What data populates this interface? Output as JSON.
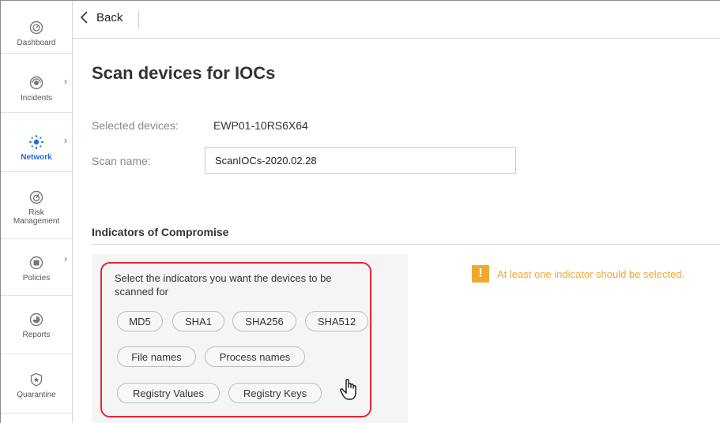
{
  "sidebar": {
    "items": [
      {
        "label": "Dashboard",
        "icon": "dashboard-icon"
      },
      {
        "label": "Incidents",
        "icon": "incidents-icon"
      },
      {
        "label": "Network",
        "icon": "network-icon"
      },
      {
        "label": "Risk Management",
        "icon": "risk-management-icon"
      },
      {
        "label": "Policies",
        "icon": "policies-icon"
      },
      {
        "label": "Reports",
        "icon": "reports-icon"
      },
      {
        "label": "Quarantine",
        "icon": "quarantine-icon"
      }
    ],
    "active_color": "#1f6fd1"
  },
  "topbar": {
    "back_label": "Back"
  },
  "page": {
    "title": "Scan devices for IOCs",
    "selected_devices_label": "Selected devices:",
    "selected_devices_value": "EWP01-10RS6X64",
    "scan_name_label": "Scan name:",
    "scan_name_value": "ScanIOCs-2020.02.28"
  },
  "ioc": {
    "section_title": "Indicators of Compromise",
    "prompt": "Select the indicators you want the devices to be scanned for",
    "chips": [
      "MD5",
      "SHA1",
      "SHA256",
      "SHA512",
      "File names",
      "Process names",
      "Registry Values",
      "Registry Keys"
    ],
    "warning": "At least one indicator should be selected.",
    "highlight_color": "#e0292f",
    "warning_color": "#f2a82f"
  }
}
